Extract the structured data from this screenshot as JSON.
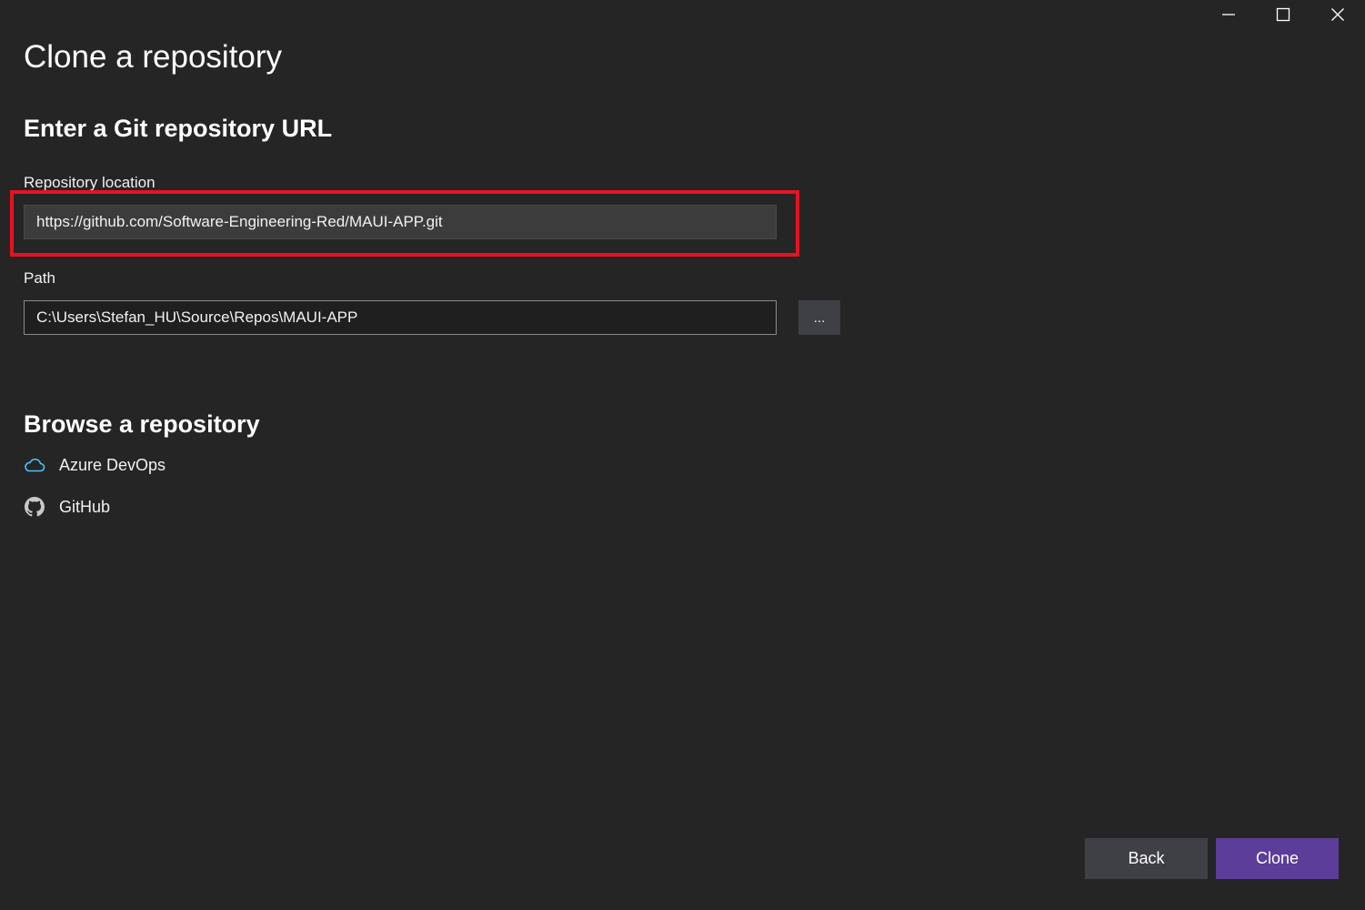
{
  "window": {
    "controls": {
      "minimize_icon": "minimize-icon",
      "maximize_icon": "maximize-icon",
      "close_icon": "close-icon"
    }
  },
  "page": {
    "title": "Clone a repository"
  },
  "enter_url": {
    "title": "Enter a Git repository URL",
    "repository_location_label": "Repository location",
    "repository_location_value": "https://github.com/Software-Engineering-Red/MAUI-APP.git",
    "path_label": "Path",
    "path_value": "C:\\Users\\Stefan_HU\\Source\\Repos\\MAUI-APP",
    "browse_button_label": "..."
  },
  "browse": {
    "title": "Browse a repository",
    "providers": [
      {
        "label": "Azure DevOps",
        "icon": "cloud-icon"
      },
      {
        "label": "GitHub",
        "icon": "github-icon"
      }
    ]
  },
  "footer": {
    "back_label": "Back",
    "clone_label": "Clone"
  },
  "colors": {
    "background": "#252526",
    "accent": "#5c3d99",
    "highlight": "#e81123",
    "azure_icon": "#4fc3f7"
  }
}
